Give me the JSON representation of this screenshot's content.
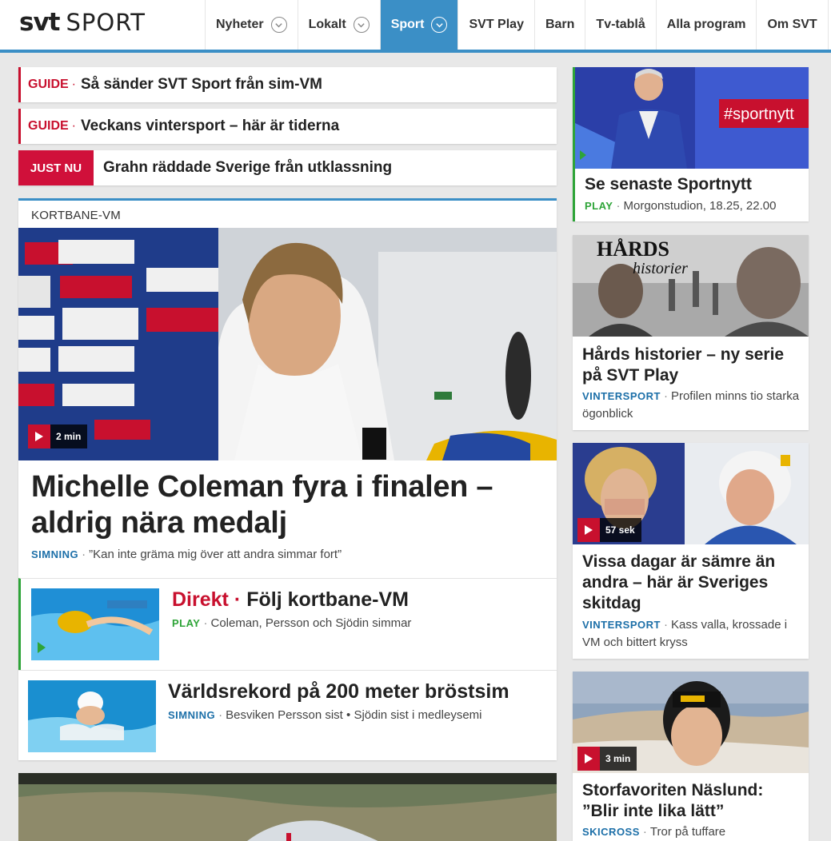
{
  "header": {
    "logo_svt": "svt",
    "logo_sport": "SPORT",
    "nav": [
      {
        "label": "Nyheter",
        "dropdown": true,
        "active": false
      },
      {
        "label": "Lokalt",
        "dropdown": true,
        "active": false
      },
      {
        "label": "Sport",
        "dropdown": true,
        "active": true
      },
      {
        "label": "SVT Play",
        "dropdown": false,
        "active": false
      },
      {
        "label": "Barn",
        "dropdown": false,
        "active": false
      },
      {
        "label": "Tv-tablå",
        "dropdown": false,
        "active": false
      },
      {
        "label": "Alla program",
        "dropdown": false,
        "active": false
      },
      {
        "label": "Om SVT",
        "dropdown": false,
        "active": false
      }
    ]
  },
  "guides": [
    {
      "tag": "GUIDE",
      "dot": "·",
      "text": "Så sänder SVT Sport från sim-VM"
    },
    {
      "tag": "GUIDE",
      "dot": "·",
      "text": "Veckans vintersport – här är tiderna"
    }
  ],
  "justnu": {
    "tag": "JUST NU",
    "text": "Grahn räddade Sverige från utklassning"
  },
  "main": {
    "kicker": "KORTBANE-VM",
    "video_duration": "2 min",
    "headline": "Michelle Coleman fyra i finalen – aldrig nära medalj",
    "section": "SIMNING",
    "dot": "·",
    "subtitle": "”Kan inte gräma mig över att andra simmar fort”",
    "rows": [
      {
        "direkt": "Direkt",
        "dot": "·",
        "title": "Följ kortbane-VM",
        "section": "PLAY",
        "meta": "Coleman, Persson och Sjödin simmar"
      },
      {
        "title": "Världsrekord på 200 meter bröstsim",
        "section": "SIMNING",
        "meta": "Besviken Persson sist • Sjödin sist i medleysemi"
      }
    ]
  },
  "side": [
    {
      "title": "Se senaste Sportnytt",
      "section": "PLAY",
      "meta": "Morgonstudion, 18.25, 22.00",
      "image_text": "#sportnytt"
    },
    {
      "title": "Hårds historier – ny serie på SVT Play",
      "section": "VINTERSPORT",
      "meta": "Profilen minns tio starka ögonblick",
      "image_text": "HÅRDS",
      "image_text2": "historier"
    },
    {
      "title": "Vissa dagar är sämre än andra – här är Sveriges skitdag",
      "section": "VINTERSPORT",
      "meta": "Kass valla, krossade i VM och bittert kryss",
      "duration": "57 sek"
    },
    {
      "title": "Storfavoriten Näslund: ”Blir inte lika lätt”",
      "section": "SKICROSS",
      "meta": "Tror på tuffare",
      "duration": "3 min"
    }
  ],
  "colors": {
    "accent": "#3b8fc6",
    "guide_red": "#c8102e",
    "live_green": "#2ea438",
    "section_blue": "#1c6fa8"
  }
}
